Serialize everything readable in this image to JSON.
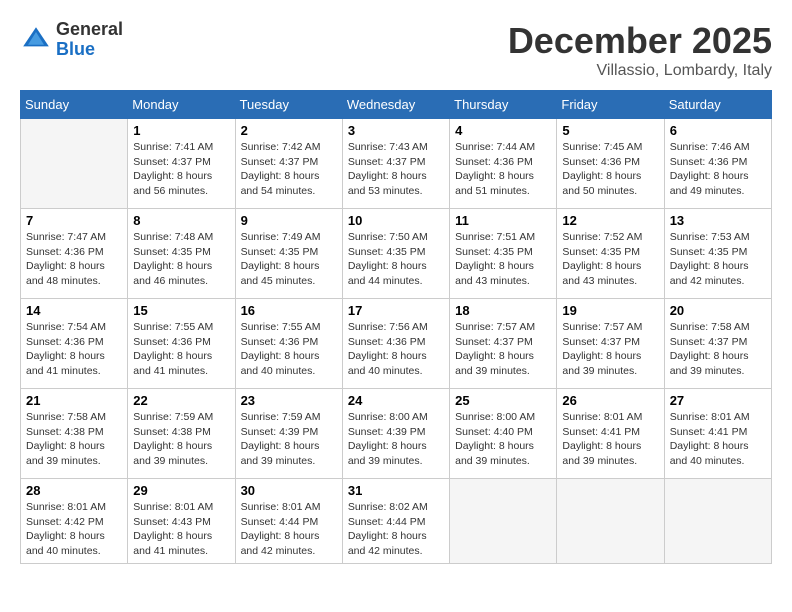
{
  "header": {
    "logo": {
      "general": "General",
      "blue": "Blue"
    },
    "month": "December 2025",
    "location": "Villassio, Lombardy, Italy"
  },
  "weekdays": [
    "Sunday",
    "Monday",
    "Tuesday",
    "Wednesday",
    "Thursday",
    "Friday",
    "Saturday"
  ],
  "weeks": [
    [
      {
        "day": "",
        "empty": true
      },
      {
        "day": "1",
        "sunrise": "7:41 AM",
        "sunset": "4:37 PM",
        "daylight": "8 hours and 56 minutes."
      },
      {
        "day": "2",
        "sunrise": "7:42 AM",
        "sunset": "4:37 PM",
        "daylight": "8 hours and 54 minutes."
      },
      {
        "day": "3",
        "sunrise": "7:43 AM",
        "sunset": "4:37 PM",
        "daylight": "8 hours and 53 minutes."
      },
      {
        "day": "4",
        "sunrise": "7:44 AM",
        "sunset": "4:36 PM",
        "daylight": "8 hours and 51 minutes."
      },
      {
        "day": "5",
        "sunrise": "7:45 AM",
        "sunset": "4:36 PM",
        "daylight": "8 hours and 50 minutes."
      },
      {
        "day": "6",
        "sunrise": "7:46 AM",
        "sunset": "4:36 PM",
        "daylight": "8 hours and 49 minutes."
      }
    ],
    [
      {
        "day": "7",
        "sunrise": "7:47 AM",
        "sunset": "4:36 PM",
        "daylight": "8 hours and 48 minutes."
      },
      {
        "day": "8",
        "sunrise": "7:48 AM",
        "sunset": "4:35 PM",
        "daylight": "8 hours and 46 minutes."
      },
      {
        "day": "9",
        "sunrise": "7:49 AM",
        "sunset": "4:35 PM",
        "daylight": "8 hours and 45 minutes."
      },
      {
        "day": "10",
        "sunrise": "7:50 AM",
        "sunset": "4:35 PM",
        "daylight": "8 hours and 44 minutes."
      },
      {
        "day": "11",
        "sunrise": "7:51 AM",
        "sunset": "4:35 PM",
        "daylight": "8 hours and 43 minutes."
      },
      {
        "day": "12",
        "sunrise": "7:52 AM",
        "sunset": "4:35 PM",
        "daylight": "8 hours and 43 minutes."
      },
      {
        "day": "13",
        "sunrise": "7:53 AM",
        "sunset": "4:35 PM",
        "daylight": "8 hours and 42 minutes."
      }
    ],
    [
      {
        "day": "14",
        "sunrise": "7:54 AM",
        "sunset": "4:36 PM",
        "daylight": "8 hours and 41 minutes."
      },
      {
        "day": "15",
        "sunrise": "7:55 AM",
        "sunset": "4:36 PM",
        "daylight": "8 hours and 41 minutes."
      },
      {
        "day": "16",
        "sunrise": "7:55 AM",
        "sunset": "4:36 PM",
        "daylight": "8 hours and 40 minutes."
      },
      {
        "day": "17",
        "sunrise": "7:56 AM",
        "sunset": "4:36 PM",
        "daylight": "8 hours and 40 minutes."
      },
      {
        "day": "18",
        "sunrise": "7:57 AM",
        "sunset": "4:37 PM",
        "daylight": "8 hours and 39 minutes."
      },
      {
        "day": "19",
        "sunrise": "7:57 AM",
        "sunset": "4:37 PM",
        "daylight": "8 hours and 39 minutes."
      },
      {
        "day": "20",
        "sunrise": "7:58 AM",
        "sunset": "4:37 PM",
        "daylight": "8 hours and 39 minutes."
      }
    ],
    [
      {
        "day": "21",
        "sunrise": "7:58 AM",
        "sunset": "4:38 PM",
        "daylight": "8 hours and 39 minutes."
      },
      {
        "day": "22",
        "sunrise": "7:59 AM",
        "sunset": "4:38 PM",
        "daylight": "8 hours and 39 minutes."
      },
      {
        "day": "23",
        "sunrise": "7:59 AM",
        "sunset": "4:39 PM",
        "daylight": "8 hours and 39 minutes."
      },
      {
        "day": "24",
        "sunrise": "8:00 AM",
        "sunset": "4:39 PM",
        "daylight": "8 hours and 39 minutes."
      },
      {
        "day": "25",
        "sunrise": "8:00 AM",
        "sunset": "4:40 PM",
        "daylight": "8 hours and 39 minutes."
      },
      {
        "day": "26",
        "sunrise": "8:01 AM",
        "sunset": "4:41 PM",
        "daylight": "8 hours and 39 minutes."
      },
      {
        "day": "27",
        "sunrise": "8:01 AM",
        "sunset": "4:41 PM",
        "daylight": "8 hours and 40 minutes."
      }
    ],
    [
      {
        "day": "28",
        "sunrise": "8:01 AM",
        "sunset": "4:42 PM",
        "daylight": "8 hours and 40 minutes."
      },
      {
        "day": "29",
        "sunrise": "8:01 AM",
        "sunset": "4:43 PM",
        "daylight": "8 hours and 41 minutes."
      },
      {
        "day": "30",
        "sunrise": "8:01 AM",
        "sunset": "4:44 PM",
        "daylight": "8 hours and 42 minutes."
      },
      {
        "day": "31",
        "sunrise": "8:02 AM",
        "sunset": "4:44 PM",
        "daylight": "8 hours and 42 minutes."
      },
      {
        "day": "",
        "empty": true
      },
      {
        "day": "",
        "empty": true
      },
      {
        "day": "",
        "empty": true
      }
    ]
  ]
}
